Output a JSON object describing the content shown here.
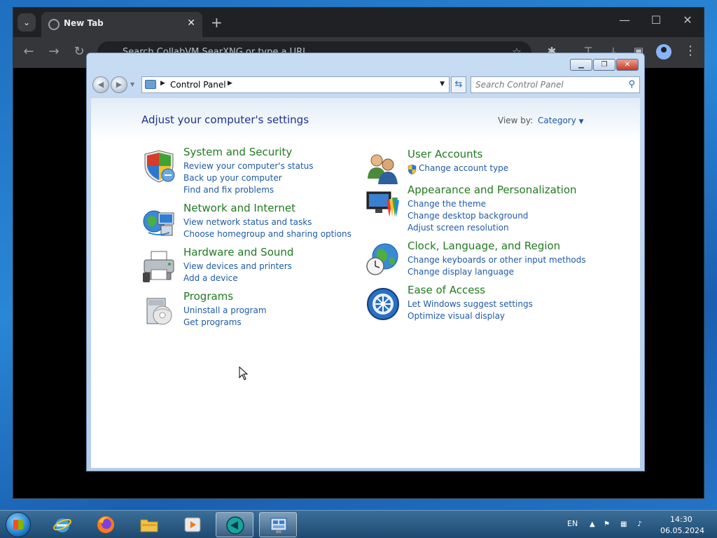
{
  "browser": {
    "tab_title": "New Tab",
    "tab_close": "✕",
    "new_tab": "+",
    "omnibox_text": "Search CollabVM SearXNG or type a URL",
    "minimize": "—",
    "maximize": "☐",
    "close": "✕"
  },
  "control_panel": {
    "breadcrumb": "Control Panel",
    "search_placeholder": "Search Control Panel",
    "heading": "Adjust your computer's settings",
    "view_by_label": "View by:",
    "view_by_value": "Category",
    "left_categories": [
      {
        "title": "System and Security",
        "icon": "shield-icon",
        "links": [
          "Review your computer's status",
          "Back up your computer",
          "Find and fix problems"
        ]
      },
      {
        "title": "Network and Internet",
        "icon": "globe-network-icon",
        "links": [
          "View network status and tasks",
          "Choose homegroup and sharing options"
        ]
      },
      {
        "title": "Hardware and Sound",
        "icon": "printer-icon",
        "links": [
          "View devices and printers",
          "Add a device"
        ]
      },
      {
        "title": "Programs",
        "icon": "programs-icon",
        "links": [
          "Uninstall a program",
          "Get programs"
        ]
      }
    ],
    "right_categories": [
      {
        "title": "User Accounts",
        "icon": "users-icon",
        "links": [
          "Change account type"
        ]
      },
      {
        "title": "Appearance and Personalization",
        "icon": "monitor-paint-icon",
        "links": [
          "Change the theme",
          "Change desktop background",
          "Adjust screen resolution"
        ]
      },
      {
        "title": "Clock, Language, and Region",
        "icon": "clock-globe-icon",
        "links": [
          "Change keyboards or other input methods",
          "Change display language"
        ]
      },
      {
        "title": "Ease of Access",
        "icon": "ease-of-access-icon",
        "links": [
          "Let Windows suggest settings",
          "Optimize visual display"
        ]
      }
    ]
  },
  "taskbar": {
    "language": "EN",
    "time": "14:30",
    "date": "06.05.2024"
  }
}
